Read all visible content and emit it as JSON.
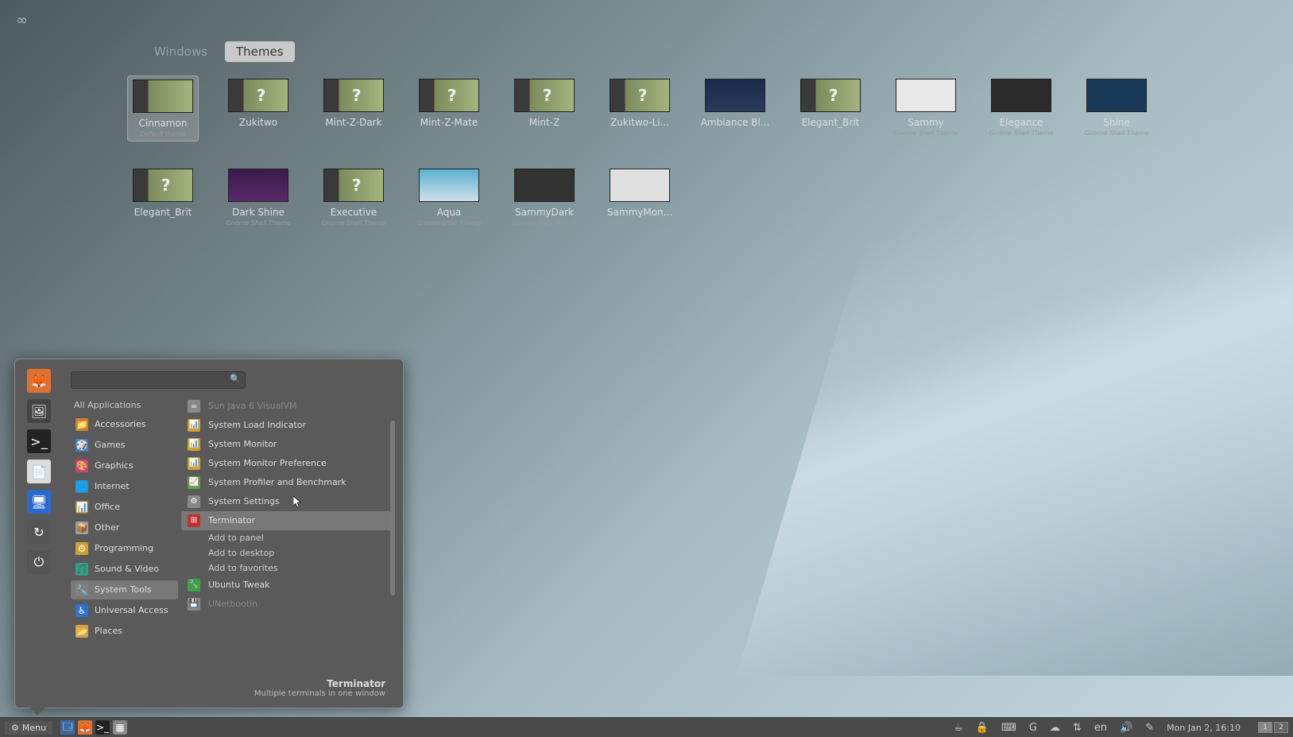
{
  "corner": "∞",
  "tabs": {
    "windows": "Windows",
    "themes": "Themes"
  },
  "themes": [
    {
      "name": "Cinnamon",
      "sub": "Default theme",
      "selected": true,
      "thumb": "grass"
    },
    {
      "name": "Zukitwo",
      "sub": "",
      "thumb": "grass-q"
    },
    {
      "name": "Mint-Z-Dark",
      "sub": "",
      "thumb": "grass-q"
    },
    {
      "name": "Mint-Z-Mate",
      "sub": "",
      "thumb": "grass-q"
    },
    {
      "name": "Mint-Z",
      "sub": "",
      "thumb": "grass-q"
    },
    {
      "name": "Zukitwo-Li...",
      "sub": "",
      "thumb": "grass-q"
    },
    {
      "name": "Ambiance Bl...",
      "sub": "",
      "thumb": "dark"
    },
    {
      "name": "Elegant_Brit",
      "sub": "",
      "thumb": "grass-q"
    },
    {
      "name": "Sammy",
      "sub": "Gnome Shell Theme",
      "thumb": "sammy"
    },
    {
      "name": "Elegance",
      "sub": "Gnome Shell Theme",
      "thumb": "elegance"
    },
    {
      "name": "Shine",
      "sub": "Gnome Shell Theme",
      "thumb": "shine"
    },
    {
      "name": "Elegant_Brit",
      "sub": "",
      "thumb": "grass-q"
    },
    {
      "name": "Dark Shine",
      "sub": "Gnome Shell Theme",
      "thumb": "darkshine"
    },
    {
      "name": "Executive",
      "sub": "Gnome Shell Theme",
      "thumb": "grass-q"
    },
    {
      "name": "Aqua",
      "sub": "Gnome Shell Theme",
      "thumb": "aqua"
    },
    {
      "name": "SammyDark",
      "sub": "Gnome Shell Theme",
      "thumb": "sammydark"
    },
    {
      "name": "SammyMon...",
      "sub": "Gnome Shell Theme",
      "thumb": "sammymon"
    }
  ],
  "menu": {
    "search_placeholder": "",
    "favorites": [
      {
        "name": "firefox",
        "bg": "#e07030",
        "glyph": "🦊"
      },
      {
        "name": "image-viewer",
        "bg": "#444",
        "glyph": "🖼"
      },
      {
        "name": "terminal",
        "bg": "#222",
        "glyph": ">_"
      },
      {
        "name": "files",
        "bg": "#ddd",
        "glyph": "📄"
      },
      {
        "name": "monitor",
        "bg": "#2a6ad0",
        "glyph": "🖥"
      },
      {
        "name": "restart",
        "bg": "#555",
        "glyph": "↻"
      },
      {
        "name": "power",
        "bg": "#555",
        "glyph": "⏻"
      }
    ],
    "all_apps": "All Applications",
    "categories": [
      {
        "name": "Accessories",
        "ico": "📁",
        "bg": "#d08030"
      },
      {
        "name": "Games",
        "ico": "🎲",
        "bg": "#4080d0"
      },
      {
        "name": "Graphics",
        "ico": "🎨",
        "bg": "#d04080"
      },
      {
        "name": "Internet",
        "ico": "🌐",
        "bg": "#3090d0"
      },
      {
        "name": "Office",
        "ico": "📊",
        "bg": "#b08030"
      },
      {
        "name": "Other",
        "ico": "📦",
        "bg": "#a0a0a0"
      },
      {
        "name": "Programming",
        "ico": "⚙",
        "bg": "#d0a030"
      },
      {
        "name": "Sound & Video",
        "ico": "🎵",
        "bg": "#30a080"
      },
      {
        "name": "System Tools",
        "ico": "🔧",
        "bg": "#808080",
        "selected": true
      },
      {
        "name": "Universal Access",
        "ico": "♿",
        "bg": "#3070d0"
      },
      {
        "name": "Places",
        "ico": "📂",
        "bg": "#d0a050"
      }
    ],
    "apps": [
      {
        "name": "Sun Java 6 VisualVM",
        "ico": "☕",
        "bg": "#888",
        "dim": true
      },
      {
        "name": "System Load Indicator",
        "ico": "📊",
        "bg": "#d0a030"
      },
      {
        "name": "System Monitor",
        "ico": "📊",
        "bg": "#d0a030"
      },
      {
        "name": "System Monitor Preference",
        "ico": "📊",
        "bg": "#d0a030"
      },
      {
        "name": "System Profiler and Benchmark",
        "ico": "📈",
        "bg": "#60a040"
      },
      {
        "name": "System Settings",
        "ico": "⚙",
        "bg": "#888"
      },
      {
        "name": "Terminator",
        "ico": "⊞",
        "bg": "#c03030",
        "highlight": true
      },
      {
        "name": "Ubuntu Tweak",
        "ico": "🔧",
        "bg": "#40a040"
      },
      {
        "name": "UNetbootin",
        "ico": "💾",
        "bg": "#888",
        "dim": true
      }
    ],
    "context": [
      "Add to panel",
      "Add to desktop",
      "Add to favorites"
    ],
    "footer_title": "Terminator",
    "footer_desc": "Multiple terminals in one window"
  },
  "taskbar": {
    "menu_label": "Menu",
    "launchers": [
      {
        "name": "show-desktop",
        "glyph": "🗔",
        "bg": "#3a6aa0"
      },
      {
        "name": "firefox",
        "glyph": "🦊",
        "bg": "#e07030"
      },
      {
        "name": "terminal",
        "glyph": ">_",
        "bg": "#222"
      },
      {
        "name": "files",
        "glyph": "▦",
        "bg": "#888"
      }
    ],
    "tray": [
      {
        "name": "coffee-icon",
        "glyph": "☕"
      },
      {
        "name": "lock-icon",
        "glyph": "🔒"
      },
      {
        "name": "keyboard-icon",
        "glyph": "⌨"
      },
      {
        "name": "google-icon",
        "glyph": "G"
      },
      {
        "name": "cloud-icon",
        "glyph": "☁"
      },
      {
        "name": "sync-icon",
        "glyph": "⇅"
      },
      {
        "name": "lang-indicator",
        "glyph": "en"
      },
      {
        "name": "volume-icon",
        "glyph": "🔊"
      },
      {
        "name": "settings-icon",
        "glyph": "✎"
      }
    ],
    "clock": "Mon Jan  2, 16:10",
    "workspaces": [
      "1",
      "2"
    ]
  }
}
